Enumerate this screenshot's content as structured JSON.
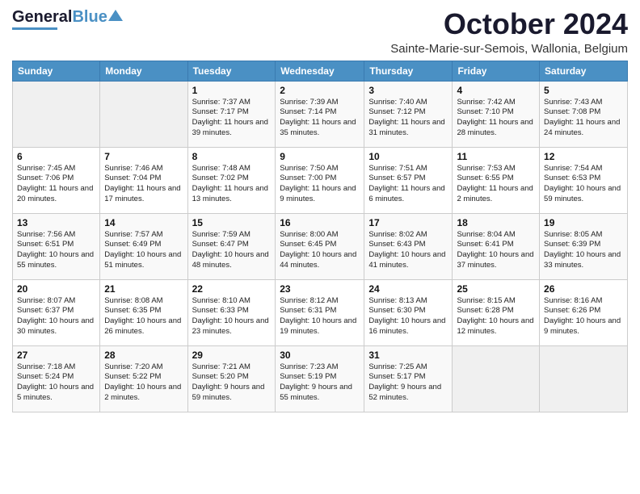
{
  "header": {
    "logo_general": "General",
    "logo_blue": "Blue",
    "month_title": "October 2024",
    "location": "Sainte-Marie-sur-Semois, Wallonia, Belgium"
  },
  "days_of_week": [
    "Sunday",
    "Monday",
    "Tuesday",
    "Wednesday",
    "Thursday",
    "Friday",
    "Saturday"
  ],
  "weeks": [
    [
      {
        "day": "",
        "info": ""
      },
      {
        "day": "",
        "info": ""
      },
      {
        "day": "1",
        "info": "Sunrise: 7:37 AM\nSunset: 7:17 PM\nDaylight: 11 hours and 39 minutes."
      },
      {
        "day": "2",
        "info": "Sunrise: 7:39 AM\nSunset: 7:14 PM\nDaylight: 11 hours and 35 minutes."
      },
      {
        "day": "3",
        "info": "Sunrise: 7:40 AM\nSunset: 7:12 PM\nDaylight: 11 hours and 31 minutes."
      },
      {
        "day": "4",
        "info": "Sunrise: 7:42 AM\nSunset: 7:10 PM\nDaylight: 11 hours and 28 minutes."
      },
      {
        "day": "5",
        "info": "Sunrise: 7:43 AM\nSunset: 7:08 PM\nDaylight: 11 hours and 24 minutes."
      }
    ],
    [
      {
        "day": "6",
        "info": "Sunrise: 7:45 AM\nSunset: 7:06 PM\nDaylight: 11 hours and 20 minutes."
      },
      {
        "day": "7",
        "info": "Sunrise: 7:46 AM\nSunset: 7:04 PM\nDaylight: 11 hours and 17 minutes."
      },
      {
        "day": "8",
        "info": "Sunrise: 7:48 AM\nSunset: 7:02 PM\nDaylight: 11 hours and 13 minutes."
      },
      {
        "day": "9",
        "info": "Sunrise: 7:50 AM\nSunset: 7:00 PM\nDaylight: 11 hours and 9 minutes."
      },
      {
        "day": "10",
        "info": "Sunrise: 7:51 AM\nSunset: 6:57 PM\nDaylight: 11 hours and 6 minutes."
      },
      {
        "day": "11",
        "info": "Sunrise: 7:53 AM\nSunset: 6:55 PM\nDaylight: 11 hours and 2 minutes."
      },
      {
        "day": "12",
        "info": "Sunrise: 7:54 AM\nSunset: 6:53 PM\nDaylight: 10 hours and 59 minutes."
      }
    ],
    [
      {
        "day": "13",
        "info": "Sunrise: 7:56 AM\nSunset: 6:51 PM\nDaylight: 10 hours and 55 minutes."
      },
      {
        "day": "14",
        "info": "Sunrise: 7:57 AM\nSunset: 6:49 PM\nDaylight: 10 hours and 51 minutes."
      },
      {
        "day": "15",
        "info": "Sunrise: 7:59 AM\nSunset: 6:47 PM\nDaylight: 10 hours and 48 minutes."
      },
      {
        "day": "16",
        "info": "Sunrise: 8:00 AM\nSunset: 6:45 PM\nDaylight: 10 hours and 44 minutes."
      },
      {
        "day": "17",
        "info": "Sunrise: 8:02 AM\nSunset: 6:43 PM\nDaylight: 10 hours and 41 minutes."
      },
      {
        "day": "18",
        "info": "Sunrise: 8:04 AM\nSunset: 6:41 PM\nDaylight: 10 hours and 37 minutes."
      },
      {
        "day": "19",
        "info": "Sunrise: 8:05 AM\nSunset: 6:39 PM\nDaylight: 10 hours and 33 minutes."
      }
    ],
    [
      {
        "day": "20",
        "info": "Sunrise: 8:07 AM\nSunset: 6:37 PM\nDaylight: 10 hours and 30 minutes."
      },
      {
        "day": "21",
        "info": "Sunrise: 8:08 AM\nSunset: 6:35 PM\nDaylight: 10 hours and 26 minutes."
      },
      {
        "day": "22",
        "info": "Sunrise: 8:10 AM\nSunset: 6:33 PM\nDaylight: 10 hours and 23 minutes."
      },
      {
        "day": "23",
        "info": "Sunrise: 8:12 AM\nSunset: 6:31 PM\nDaylight: 10 hours and 19 minutes."
      },
      {
        "day": "24",
        "info": "Sunrise: 8:13 AM\nSunset: 6:30 PM\nDaylight: 10 hours and 16 minutes."
      },
      {
        "day": "25",
        "info": "Sunrise: 8:15 AM\nSunset: 6:28 PM\nDaylight: 10 hours and 12 minutes."
      },
      {
        "day": "26",
        "info": "Sunrise: 8:16 AM\nSunset: 6:26 PM\nDaylight: 10 hours and 9 minutes."
      }
    ],
    [
      {
        "day": "27",
        "info": "Sunrise: 7:18 AM\nSunset: 5:24 PM\nDaylight: 10 hours and 5 minutes."
      },
      {
        "day": "28",
        "info": "Sunrise: 7:20 AM\nSunset: 5:22 PM\nDaylight: 10 hours and 2 minutes."
      },
      {
        "day": "29",
        "info": "Sunrise: 7:21 AM\nSunset: 5:20 PM\nDaylight: 9 hours and 59 minutes."
      },
      {
        "day": "30",
        "info": "Sunrise: 7:23 AM\nSunset: 5:19 PM\nDaylight: 9 hours and 55 minutes."
      },
      {
        "day": "31",
        "info": "Sunrise: 7:25 AM\nSunset: 5:17 PM\nDaylight: 9 hours and 52 minutes."
      },
      {
        "day": "",
        "info": ""
      },
      {
        "day": "",
        "info": ""
      }
    ]
  ]
}
